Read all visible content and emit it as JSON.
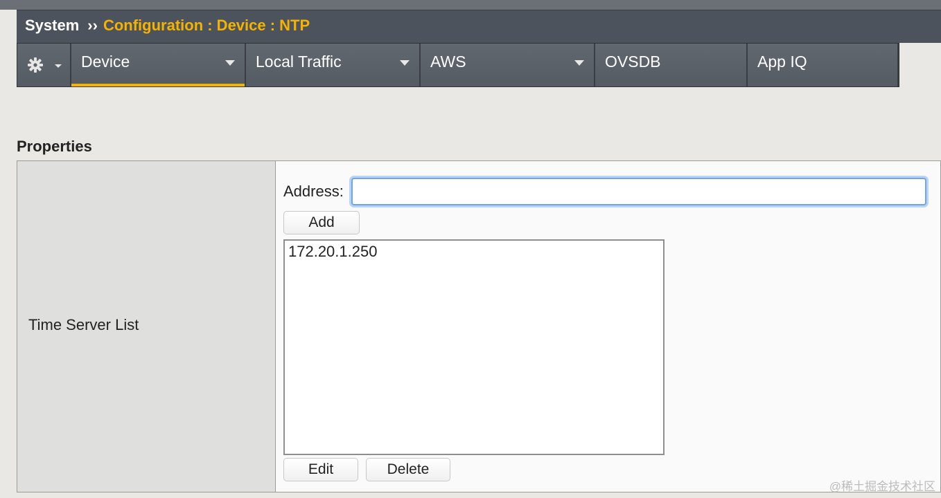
{
  "breadcrumb": {
    "root": "System",
    "separator": "››",
    "path": "Configuration : Device : NTP"
  },
  "tabs": [
    {
      "label": "",
      "icon": "gear-icon"
    },
    {
      "label": "Device",
      "active": true
    },
    {
      "label": "Local Traffic"
    },
    {
      "label": "AWS"
    },
    {
      "label": "OVSDB"
    },
    {
      "label": "App IQ"
    }
  ],
  "section": {
    "title": "Properties"
  },
  "time_server": {
    "row_label": "Time Server List",
    "address_label": "Address:",
    "address_value": "",
    "add_label": "Add",
    "servers": [
      "172.20.1.250"
    ],
    "edit_label": "Edit",
    "delete_label": "Delete"
  },
  "watermark": "@稀土掘金技术社区",
  "colors": {
    "accent": "#f5b301",
    "tabbar": "#5a6069",
    "focus": "#6fa4e8"
  }
}
